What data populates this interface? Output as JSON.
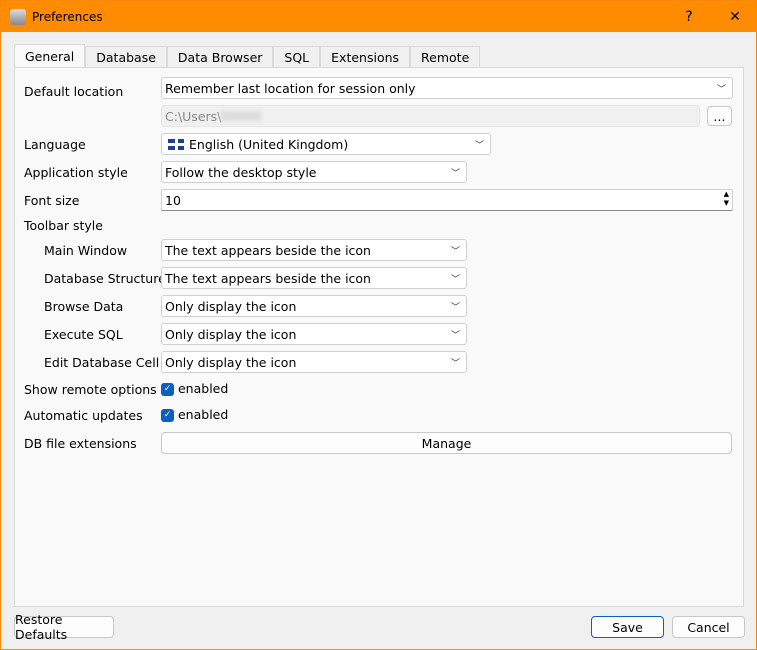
{
  "window": {
    "title": "Preferences",
    "help": "?",
    "close": "✕"
  },
  "tabs": [
    "General",
    "Database",
    "Data Browser",
    "SQL",
    "Extensions",
    "Remote"
  ],
  "general": {
    "default_location_label": "Default location",
    "default_location_value": "Remember last location for session only",
    "path_value": "C:\\Users\\",
    "browse_label": "...",
    "language_label": "Language",
    "language_value": "English (United Kingdom)",
    "app_style_label": "Application style",
    "app_style_value": "Follow the desktop style",
    "font_size_label": "Font size",
    "font_size_value": "10",
    "toolbar_style_label": "Toolbar style",
    "toolbar": [
      {
        "label": "Main Window",
        "value": "The text appears beside the icon"
      },
      {
        "label": "Database Structure",
        "value": "The text appears beside the icon"
      },
      {
        "label": "Browse Data",
        "value": "Only display the icon"
      },
      {
        "label": "Execute SQL",
        "value": "Only display the icon"
      },
      {
        "label": "Edit Database Cell",
        "value": "Only display the icon"
      }
    ],
    "remote_label": "Show remote options",
    "remote_value": "enabled",
    "updates_label": "Automatic updates",
    "updates_value": "enabled",
    "ext_label": "DB file extensions",
    "manage_label": "Manage"
  },
  "footer": {
    "restore": "Restore Defaults",
    "save": "Save",
    "cancel": "Cancel"
  }
}
